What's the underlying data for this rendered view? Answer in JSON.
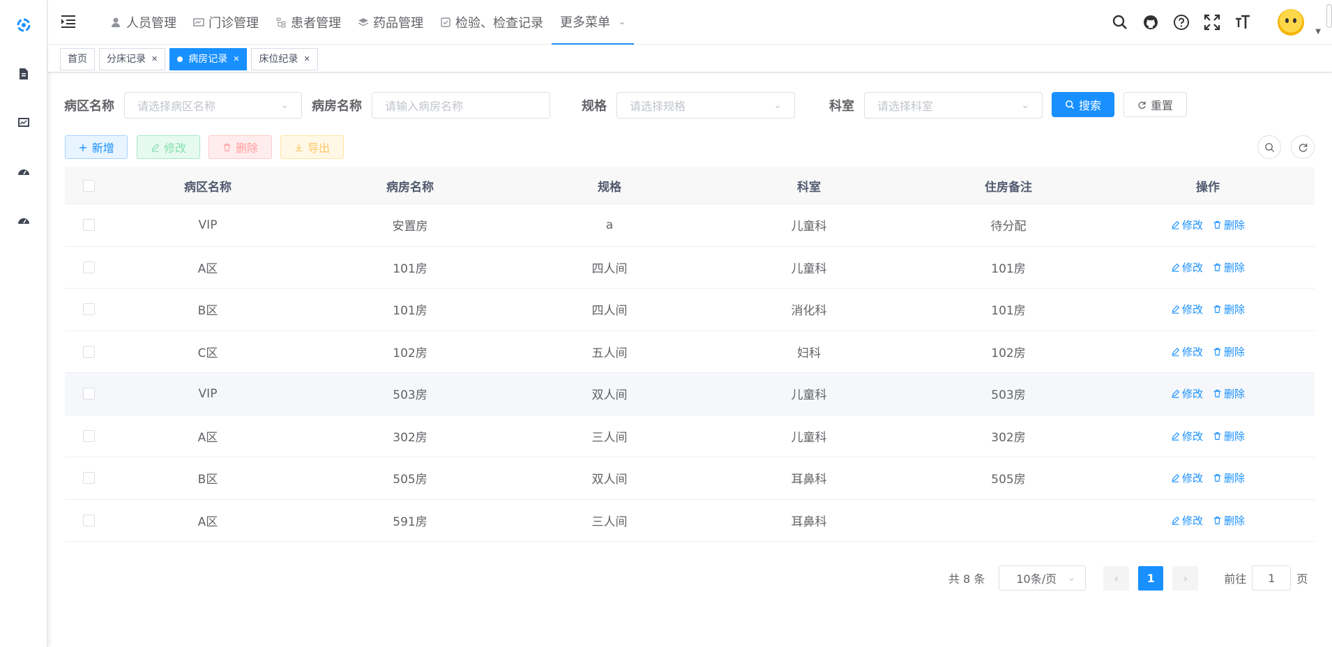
{
  "nav": {
    "menu": [
      {
        "label": "人员管理",
        "icon": "user-icon"
      },
      {
        "label": "门诊管理",
        "icon": "monitor-icon"
      },
      {
        "label": "患者管理",
        "icon": "tree-icon"
      },
      {
        "label": "药品管理",
        "icon": "layers-icon"
      },
      {
        "label": "检验、检查记录",
        "icon": "checkbox-icon"
      },
      {
        "label": "更多菜单",
        "icon": "chevron-down-icon"
      }
    ]
  },
  "tags": [
    {
      "label": "首页",
      "active": false
    },
    {
      "label": "分床记录",
      "active": false
    },
    {
      "label": "病房记录",
      "active": true
    },
    {
      "label": "床位纪录",
      "active": false
    }
  ],
  "search": {
    "ward_label": "病区名称",
    "ward_placeholder": "请选择病区名称",
    "room_label": "病房名称",
    "room_placeholder": "请输入病房名称",
    "spec_label": "规格",
    "spec_placeholder": "请选择规格",
    "dept_label": "科室",
    "dept_placeholder": "请选择科室",
    "search_btn": "搜索",
    "reset_btn": "重置"
  },
  "toolbar": {
    "add": "新增",
    "edit": "修改",
    "delete": "删除",
    "export": "导出"
  },
  "table": {
    "headers": [
      "病区名称",
      "病房名称",
      "规格",
      "科室",
      "住房备注",
      "操作"
    ],
    "rows": [
      [
        "VIP",
        "安置房",
        "a",
        "儿童科",
        "待分配"
      ],
      [
        "A区",
        "101房",
        "四人间",
        "儿童科",
        "101房"
      ],
      [
        "B区",
        "101房",
        "四人间",
        "消化科",
        "101房"
      ],
      [
        "C区",
        "102房",
        "五人间",
        "妇科",
        "102房"
      ],
      [
        "VIP",
        "503房",
        "双人间",
        "儿童科",
        "503房"
      ],
      [
        "A区",
        "302房",
        "三人间",
        "儿童科",
        "302房"
      ],
      [
        "B区",
        "505房",
        "双人间",
        "耳鼻科",
        "505房"
      ],
      [
        "A区",
        "591房",
        "三人间",
        "耳鼻科",
        ""
      ]
    ],
    "row_edit": "修改",
    "row_delete": "删除"
  },
  "pagination": {
    "total": "共 8 条",
    "page_size": "10条/页",
    "current": "1",
    "goto_label": "前往",
    "goto_value": "1",
    "page_unit": "页"
  },
  "colors": {
    "primary": "#1890ff"
  }
}
